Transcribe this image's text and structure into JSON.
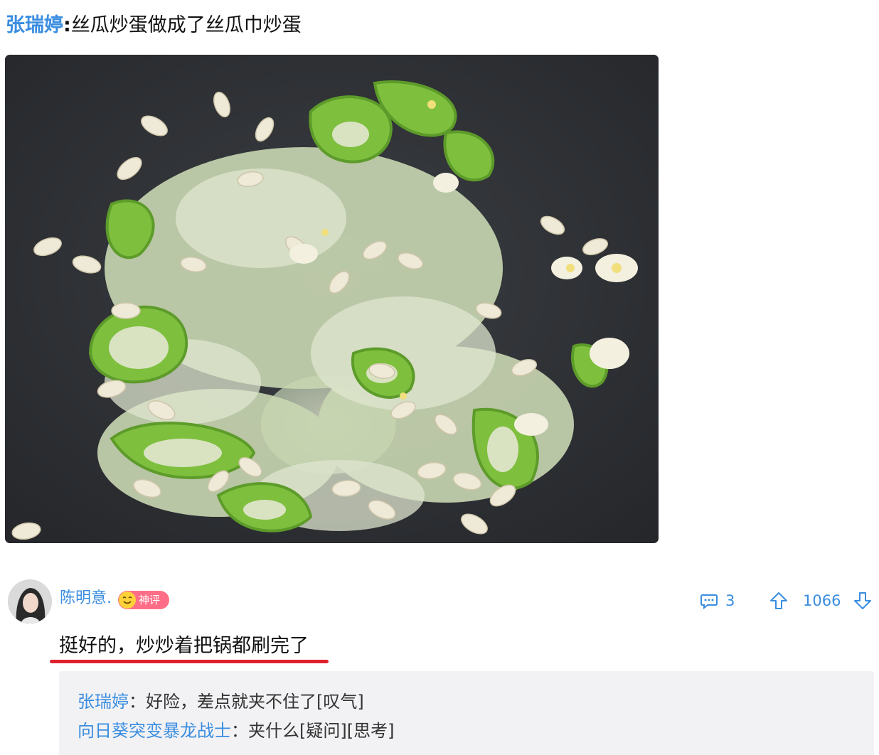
{
  "post": {
    "author": "张瑞婷",
    "separator": ":",
    "text": "丝瓜炒蛋做成了丝瓜巾炒蛋"
  },
  "photo": {
    "subject": "stir-fried-loofah-and-egg-in-wok"
  },
  "comment": {
    "user": "陈明意.",
    "badge": "神评",
    "text": "挺好的，炒炒着把锅都刷完了",
    "reply_count": "3",
    "upvotes": "1066",
    "highlight_color": "#e0202c"
  },
  "replies": [
    {
      "name": "张瑞婷",
      "separator": "：",
      "text": "好险，差点就夹不住了[叹气]"
    },
    {
      "name": "向日葵突变暴龙战士",
      "separator": "：",
      "text": "夹什么[疑问][思考]"
    }
  ],
  "colors": {
    "link_blue": "#3a8de0",
    "badge_pink": "#ff6e86",
    "reply_bg": "#f2f2f4"
  }
}
